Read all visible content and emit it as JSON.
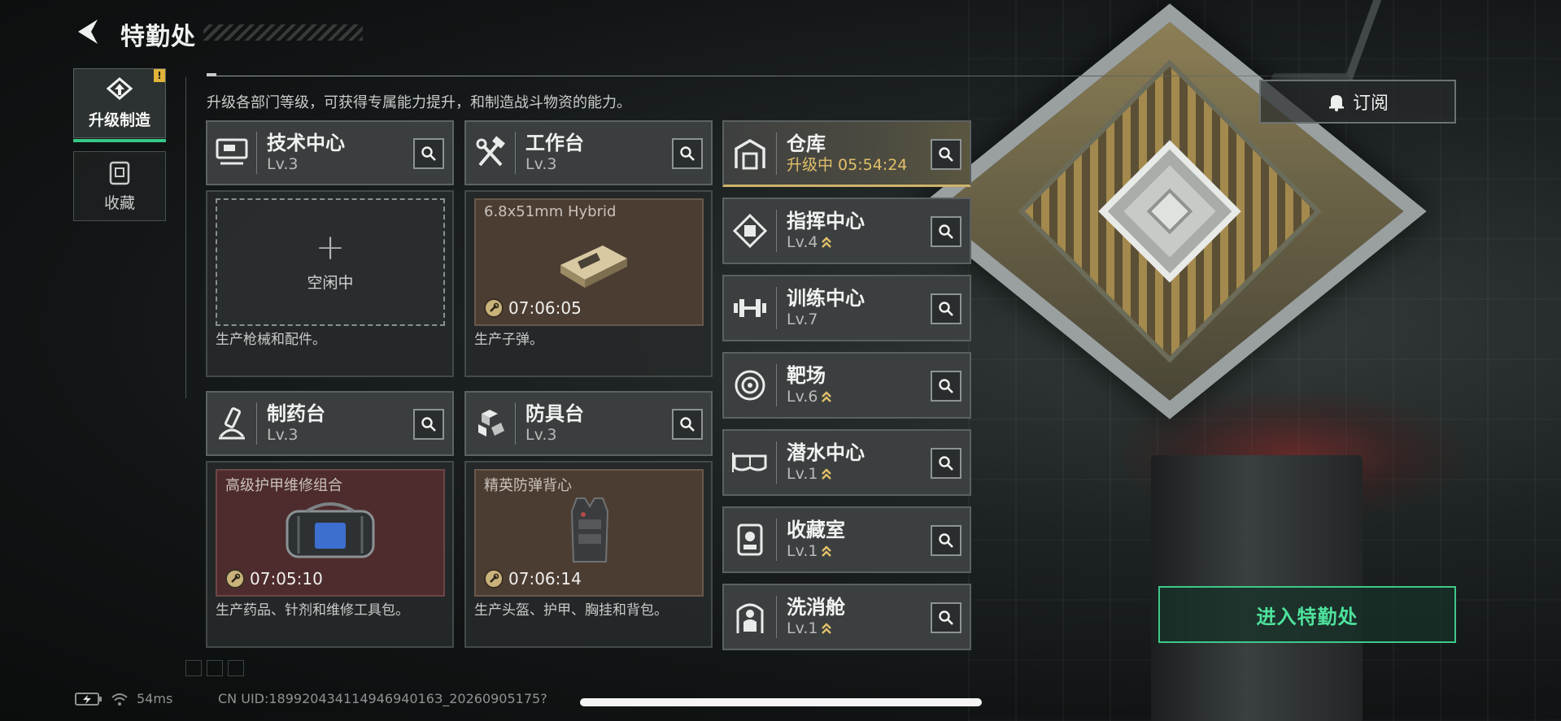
{
  "header": {
    "title": "特勤处",
    "back_icon": "back-arrow-icon"
  },
  "tabs": [
    {
      "label": "升级制造",
      "icon": "upgrade-icon",
      "active": true,
      "alert": "!"
    },
    {
      "label": "收藏",
      "icon": "collection-icon",
      "active": false
    }
  ],
  "subtitle": "升级各部门等级，可获得专属能力提升，和制造战斗物资的能力。",
  "production": [
    {
      "name": "技术中心",
      "level": "Lv.3",
      "icon": "tech-center-icon",
      "slot": {
        "state": "empty",
        "plus": "+",
        "label": "空闲中"
      },
      "desc": "生产枪械和配件。"
    },
    {
      "name": "工作台",
      "level": "Lv.3",
      "icon": "workbench-icon",
      "slot": {
        "state": "producing",
        "item": "6.8x51mm Hybrid",
        "timer": "07:06:05",
        "theme": "brown"
      },
      "desc": "生产子弹。"
    },
    {
      "name": "制药台",
      "level": "Lv.3",
      "icon": "pharmacy-icon",
      "slot": {
        "state": "producing",
        "item": "高级护甲维修组合",
        "timer": "07:05:10",
        "theme": "red"
      },
      "desc": "生产药品、针剂和维修工具包。"
    },
    {
      "name": "防具台",
      "level": "Lv.3",
      "icon": "armor-bench-icon",
      "slot": {
        "state": "producing",
        "item": "精英防弹背心",
        "timer": "07:06:14",
        "theme": "brown"
      },
      "desc": "生产头盔、护甲、胸挂和背包。"
    }
  ],
  "facilities": [
    {
      "name": "仓库",
      "status": "升级中 05:54:24",
      "icon": "warehouse-icon",
      "upgrading": true
    },
    {
      "name": "指挥中心",
      "level": "Lv.4",
      "icon": "command-center-icon",
      "upgradable": true
    },
    {
      "name": "训练中心",
      "level": "Lv.7",
      "icon": "training-center-icon",
      "upgradable": false
    },
    {
      "name": "靶场",
      "level": "Lv.6",
      "icon": "shooting-range-icon",
      "upgradable": true
    },
    {
      "name": "潜水中心",
      "level": "Lv.1",
      "icon": "diving-center-icon",
      "upgradable": true
    },
    {
      "name": "收藏室",
      "level": "Lv.1",
      "icon": "collection-room-icon",
      "upgradable": true
    },
    {
      "name": "洗消舱",
      "level": "Lv.1",
      "icon": "decontamination-icon",
      "upgradable": true
    }
  ],
  "subscribe": {
    "label": "订阅",
    "icon": "bell-icon"
  },
  "enter_button": "进入特勤处",
  "footer": {
    "ping": "54ms",
    "uid": "CN UID:18992043411494694016З_20260905175?"
  },
  "colors": {
    "accent_green": "#3ec98a",
    "upgrade_gold": "#e2c06a",
    "alert_yellow": "#e0b43a"
  }
}
